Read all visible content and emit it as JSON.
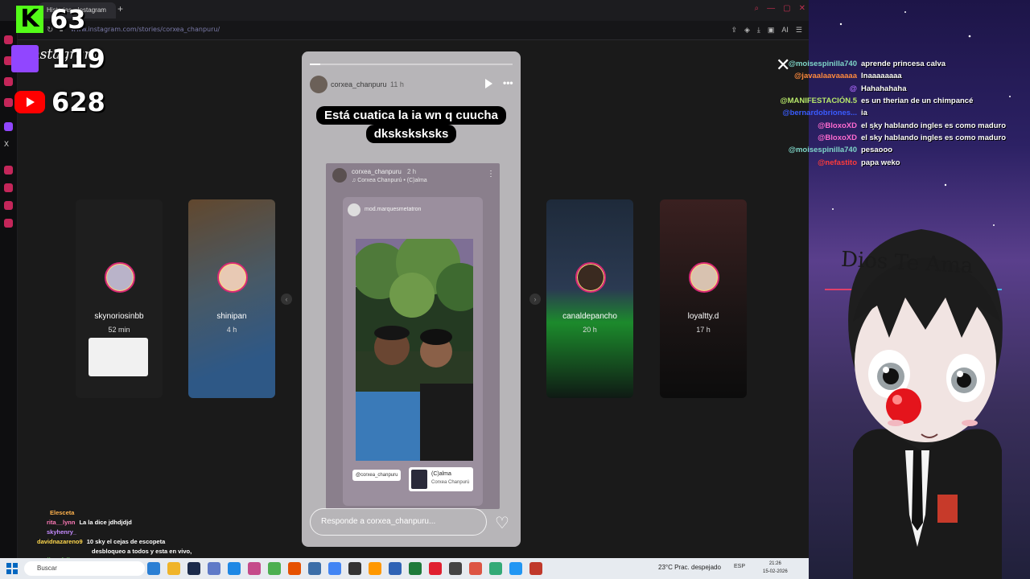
{
  "browser": {
    "tab_title": "Historias • Instagram",
    "new_tab": "+",
    "url": "www.instagram.com/stories/corxea_chanpuru/",
    "ai_label": "AI"
  },
  "instagram": {
    "logo": "Instagram",
    "side_stories": [
      {
        "user": "skynoriosinbb",
        "time": "52 min"
      },
      {
        "user": "shinipan",
        "time": "4 h"
      },
      {
        "user": "canaldepancho",
        "time": "20 h"
      },
      {
        "user": "loyaltty.d",
        "time": "17 h"
      }
    ],
    "story": {
      "user": "corxea_chanpuru",
      "time": "11 h",
      "caption": "Está cuatica la ia wn q cuucha dksksksksks",
      "inner_user": "corxea_chanpuru",
      "inner_time": "2 h",
      "inner_sub": "♫ Corxea Chanpurú • (C)alma",
      "mod_name": "mod.marquesmetatron",
      "mention": "@corxea_chanpuru",
      "music_title": "(C)alma",
      "music_artist": "Corxea Chanpurú",
      "reply_placeholder": "Responde a corxea_chanpuru..."
    }
  },
  "counters": {
    "kick": "63",
    "twitch": "119",
    "youtube": "628"
  },
  "chat": [
    {
      "user": "@moisespinilla740",
      "msg": "aprende princesa calva",
      "color": "#7fd6c8"
    },
    {
      "user": "@javaalaavaaaaa",
      "msg": "Inaaaaaaaa",
      "color": "#ff8a3d"
    },
    {
      "user": "@",
      "msg": "Hahahahaha",
      "color": "#b06bff"
    },
    {
      "user": "@MANIFESTACIÓN.5",
      "msg": "es un therian de un chimpancé",
      "color": "#b7e86a"
    },
    {
      "user": "@bernardobriones...",
      "msg": "ia",
      "color": "#3a5cff"
    },
    {
      "user": "@BloxoXD",
      "msg": "el sky hablando ingles es como maduro",
      "color": "#ff6bd0"
    },
    {
      "user": "@BloxoXD",
      "msg": "el sky hablando ingles es como maduro",
      "color": "#ff6bd0"
    },
    {
      "user": "@moisespinilla740",
      "msg": "pesaooo",
      "color": "#7fd6c8"
    },
    {
      "user": "@nefastito",
      "msg": "papa weko",
      "color": "#ff3b3b"
    }
  ],
  "overlay_text": "Dios Te Ama",
  "bottom_chat": [
    {
      "user": "Elesceta",
      "msg": "",
      "color": "#ffb24d"
    },
    {
      "user": "rita__lynn",
      "msg": "La la dice jdhdjdjd",
      "color": "#ff7ab8"
    },
    {
      "user": "skyhenry_",
      "msg": "",
      "color": "#c58bff"
    },
    {
      "user": "davidnazareno9",
      "msg": "10 sky el cejas de escopeta",
      "color": "#ffd84d"
    },
    {
      "user": "",
      "msg": "desbloqueo a todos y esta en vivo,",
      "color": "#ffffff"
    },
    {
      "user": "diegofelipe10",
      "msg": "",
      "color": "#7cff6b"
    }
  ],
  "taskbar": {
    "search": "Buscar",
    "weather": "23°C  Prac. despejado",
    "lang": "ESP",
    "time": "21:26",
    "date": "15-02-2026"
  }
}
